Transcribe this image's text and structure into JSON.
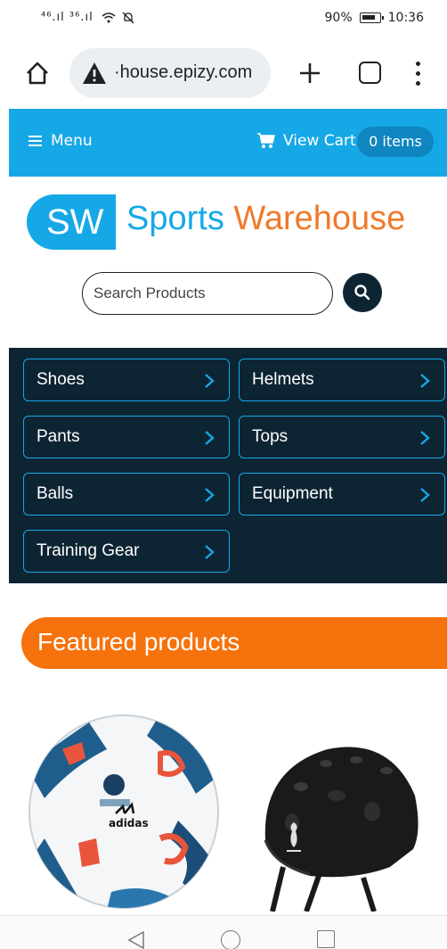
{
  "status_bar": {
    "signal_text": "⁴⁶.ıl ³⁶.ıl",
    "battery_percent": "90%",
    "time": "10:36"
  },
  "browser": {
    "url": "·house.epizy.com"
  },
  "topnav": {
    "menu_label": "Menu",
    "cart_label": "View Cart",
    "items_label": "0 items"
  },
  "logo": {
    "badge": "SW",
    "word1": "Sports",
    "word2": "Warehouse",
    "colors": {
      "blue": "#16a8e6",
      "orange": "#f07a2a"
    }
  },
  "search": {
    "placeholder": "Search Products"
  },
  "categories": [
    {
      "label": "Shoes"
    },
    {
      "label": "Helmets"
    },
    {
      "label": "Pants"
    },
    {
      "label": "Tops"
    },
    {
      "label": "Balls"
    },
    {
      "label": "Equipment"
    },
    {
      "label": "Training Gear"
    }
  ],
  "featured": {
    "title": "Featured products"
  },
  "products": [
    {
      "icon": "soccer-ball-image"
    },
    {
      "icon": "helmet-image"
    }
  ]
}
